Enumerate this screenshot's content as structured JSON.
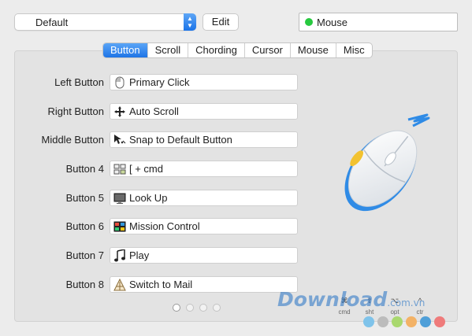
{
  "profile": {
    "value": "Default",
    "edit_label": "Edit"
  },
  "device": {
    "name": "Mouse",
    "status_color": "#27c93f"
  },
  "tabs": [
    {
      "label": "Button",
      "active": true
    },
    {
      "label": "Scroll",
      "active": false
    },
    {
      "label": "Chording",
      "active": false
    },
    {
      "label": "Cursor",
      "active": false
    },
    {
      "label": "Mouse",
      "active": false
    },
    {
      "label": "Misc",
      "active": false
    }
  ],
  "buttons": [
    {
      "label": "Left Button",
      "action": "Primary Click",
      "icon": "mouse-click-icon"
    },
    {
      "label": "Right Button",
      "action": "Auto Scroll",
      "icon": "move-arrows-icon"
    },
    {
      "label": "Middle Button",
      "action": "Snap to Default Button",
      "icon": "cursor-snap-icon"
    },
    {
      "label": "Button 4",
      "action": "[ + cmd",
      "icon": "keyboard-shortcut-icon"
    },
    {
      "label": "Button 5",
      "action": "Look Up",
      "icon": "monitor-icon"
    },
    {
      "label": "Button 6",
      "action": "Mission Control",
      "icon": "mission-control-icon"
    },
    {
      "label": "Button 7",
      "action": "Play",
      "icon": "music-note-icon"
    },
    {
      "label": "Button 8",
      "action": "Switch to Mail",
      "icon": "mail-app-icon"
    }
  ],
  "pager": {
    "pages": 4,
    "current": 1
  },
  "modifiers": [
    {
      "symbol": "⌘",
      "caption": "cmd"
    },
    {
      "symbol": "⇧",
      "caption": "sht"
    },
    {
      "symbol": "⌥",
      "caption": "opt"
    },
    {
      "symbol": "^",
      "caption": "ctr"
    }
  ],
  "watermark": {
    "text": "Download",
    "ext": ".com.vn"
  },
  "colors": {
    "accent": "#1e74e6",
    "mouse_blue": "#2f8be6",
    "mouse_yellow": "#f2c230",
    "wm_dots": [
      "#7fc3ea",
      "#bcbcbc",
      "#a9d86e",
      "#f3b266",
      "#4f9fd8",
      "#ef7b7b"
    ]
  }
}
